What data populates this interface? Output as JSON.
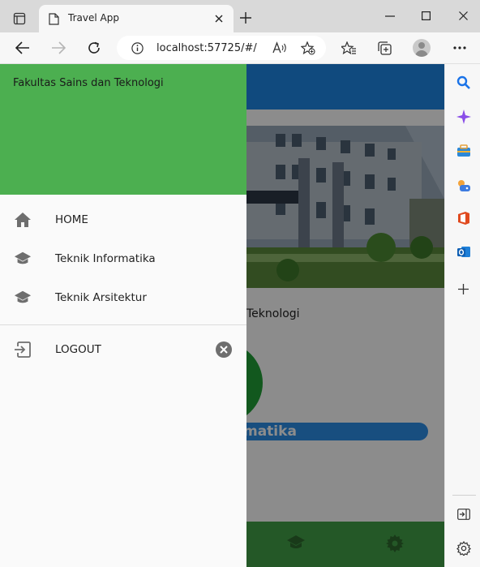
{
  "browser": {
    "tab_title": "Travel App",
    "url": "localhost:57725/#/"
  },
  "background": {
    "subtitle_fragment": "Teknologi",
    "button_fragment": "matika"
  },
  "drawer": {
    "header_title": "Fakultas Sains dan Teknologi",
    "items": [
      {
        "label": "HOME",
        "icon": "home-icon"
      },
      {
        "label": "Teknik Informatika",
        "icon": "school-icon"
      },
      {
        "label": "Teknik Arsitektur",
        "icon": "school-icon"
      }
    ],
    "logout_label": "LOGOUT"
  },
  "colors": {
    "drawer_header": "#4caf50",
    "app_bar": "#1e88e5",
    "bottom_nav": "#43a047"
  }
}
